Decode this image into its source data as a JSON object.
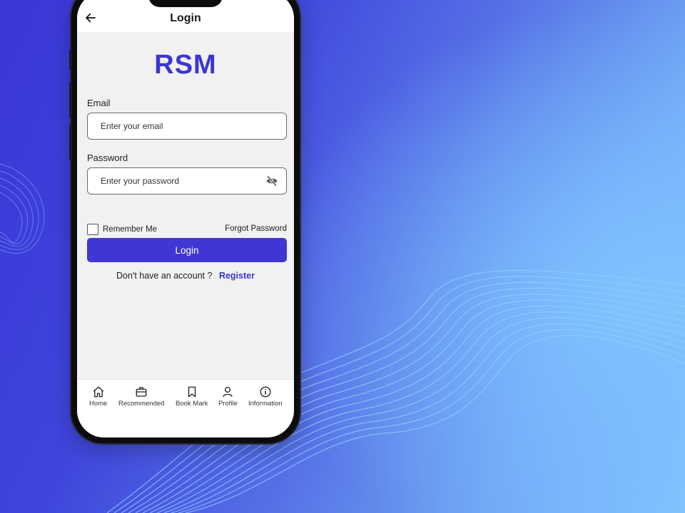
{
  "app": {
    "title": "Login",
    "brand": "RSM"
  },
  "form": {
    "email_label": "Email",
    "email_placeholder": "Enter your email",
    "password_label": "Password",
    "password_placeholder": "Enter your password",
    "remember_label": "Remember Me",
    "forgot_label": "Forgot Password",
    "login_label": "Login",
    "no_account_text": "Don't have an account ?",
    "register_label": "Register"
  },
  "nav": {
    "items": [
      {
        "label": "Home",
        "icon": "home-icon"
      },
      {
        "label": "Recommended",
        "icon": "briefcase-icon"
      },
      {
        "label": "Book Mark",
        "icon": "bookmark-icon"
      },
      {
        "label": "Profile",
        "icon": "profile-icon"
      },
      {
        "label": "Information",
        "icon": "info-icon"
      }
    ]
  },
  "colors": {
    "brand": "#3b36d1",
    "button": "#3e37d4",
    "background_start": "#3b36d6",
    "background_end": "#7fc3ff"
  }
}
